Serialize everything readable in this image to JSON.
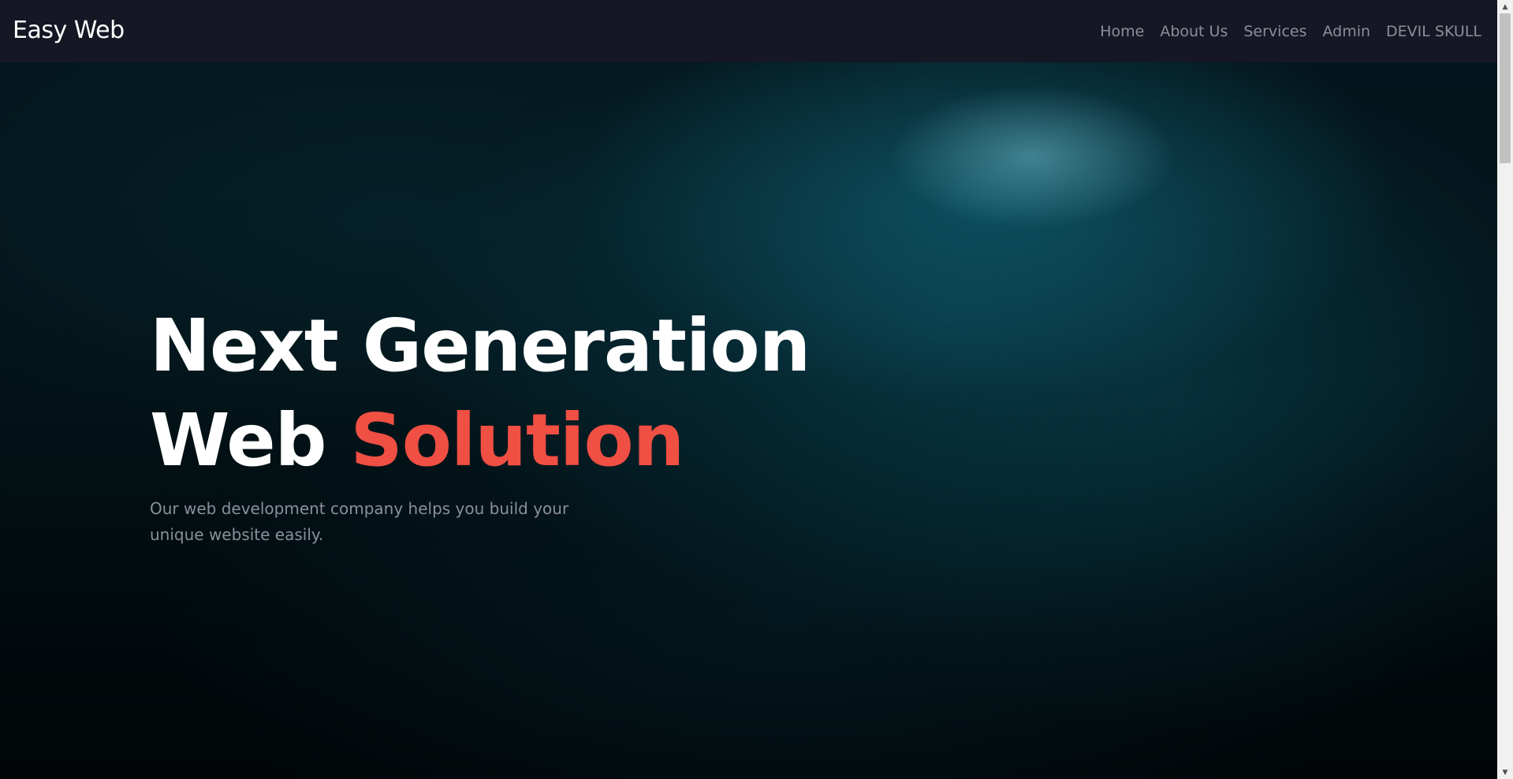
{
  "navbar": {
    "brand": "Easy Web",
    "links": [
      {
        "label": "Home"
      },
      {
        "label": "About Us"
      },
      {
        "label": "Services"
      },
      {
        "label": "Admin"
      },
      {
        "label": "DEVIL SKULL"
      }
    ]
  },
  "hero": {
    "title_line1": "Next Generation",
    "title_line2_part1": "Web ",
    "title_line2_accent": "Solution",
    "subtitle": "Our web development company helps you build your unique website easily."
  },
  "colors": {
    "navbar_bg": "#151724",
    "accent": "#f04f43",
    "text_white": "#ffffff",
    "muted_text": "#8b8f9b"
  },
  "icons": {
    "scroll_up": "scroll-up-arrow-icon",
    "scroll_down": "scroll-down-arrow-icon"
  }
}
